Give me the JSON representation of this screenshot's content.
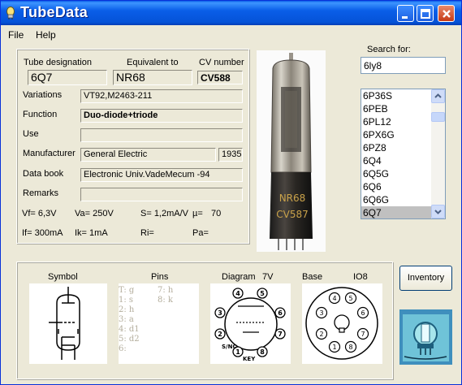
{
  "window": {
    "title": "TubeData"
  },
  "menu": [
    {
      "label": "File"
    },
    {
      "label": "Help"
    }
  ],
  "tube": {
    "designation_label": "Tube designation",
    "designation": "6Q7",
    "equivalent_label": "Equivalent to",
    "equivalent": "NR68",
    "cv_label": "CV number",
    "cv": "CV588",
    "variations_label": "Variations",
    "variations": "VT92,M2463-211",
    "function_label": "Function",
    "function": "Duo-diode+triode",
    "use_label": "Use",
    "use": "",
    "manufacturer_label": "Manufacturer",
    "manufacturer": "General Electric",
    "year": "1935",
    "databook_label": "Data book",
    "databook": "Electronic Univ.VadeMecum -94",
    "remarks_label": "Remarks",
    "remarks": ""
  },
  "params": {
    "vf": "Vf= 6,3V",
    "va": "Va= 250V",
    "s": "S= 1,2mA/V",
    "mu": "µ=",
    "mu_value": "70",
    "if": "If= 300mA",
    "ik": "Ik= 1mA",
    "ri": "Ri=",
    "pa": "Pa="
  },
  "photo": {
    "marking_1": "NR68",
    "marking_2": "CV587"
  },
  "search": {
    "label": "Search for:",
    "value": "6ly8"
  },
  "tube_list": {
    "items": [
      "6P36S",
      "6PEB",
      "6PL12",
      "6PX6G",
      "6PZ8",
      "6Q4",
      "6Q5G",
      "6Q6",
      "6Q6G",
      "6Q7"
    ],
    "selected": "6Q7"
  },
  "lower": {
    "symbol_label": "Symbol",
    "pins_label": "Pins",
    "diagram_label": "Diagram",
    "diagram_code": "7V",
    "base_label": "Base",
    "base_code": "IO8",
    "pins": [
      {
        "col1": "T: g",
        "col2": "7: h"
      },
      {
        "col1": "1: s",
        "col2": "8: k"
      },
      {
        "col1": "2: h",
        "col2": ""
      },
      {
        "col1": "3: a",
        "col2": ""
      },
      {
        "col1": "4: d1",
        "col2": ""
      },
      {
        "col1": "5: d2",
        "col2": ""
      },
      {
        "col1": "6:",
        "col2": ""
      }
    ],
    "diagram_pin_numbers": [
      "1",
      "2",
      "3",
      "4",
      "5",
      "6",
      "7",
      "8"
    ],
    "diagram_key_label": "KEY",
    "diagram_snc_label": "S/NC",
    "base_pin_numbers": [
      "1",
      "2",
      "3",
      "4",
      "5",
      "6",
      "7",
      "8"
    ]
  },
  "inventory_button": "Inventory",
  "colors": {
    "titlebar": "#0a5ee8",
    "selection": "#c0c0c0",
    "pins_text": "#b4ae9d"
  }
}
